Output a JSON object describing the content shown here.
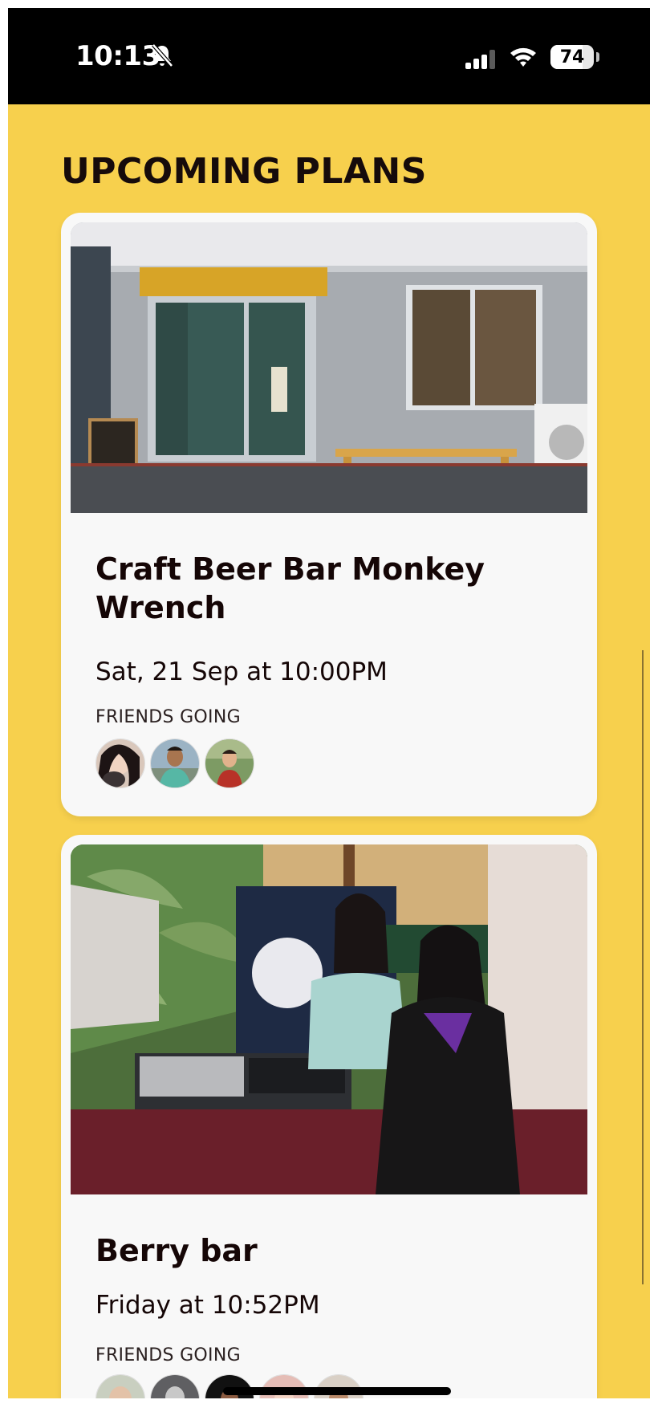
{
  "status": {
    "time": "10:13",
    "battery_level": "74",
    "battery_fraction": 0.74,
    "icons": [
      "bell-slash-icon",
      "cellular-signal-icon",
      "wifi-icon",
      "battery-icon"
    ]
  },
  "page": {
    "title": "UPCOMING PLANS",
    "background_color": "#F7D04D"
  },
  "plans": [
    {
      "title": "Craft Beer Bar Monkey Wrench",
      "time": "Sat, 21 Sep at 10:00PM",
      "friends_label": "FRIENDS GOING",
      "friends_count": 3
    },
    {
      "title": "Berry bar",
      "time": "Friday at 10:52PM",
      "friends_label": "FRIENDS GOING",
      "friends_count": 5
    }
  ]
}
